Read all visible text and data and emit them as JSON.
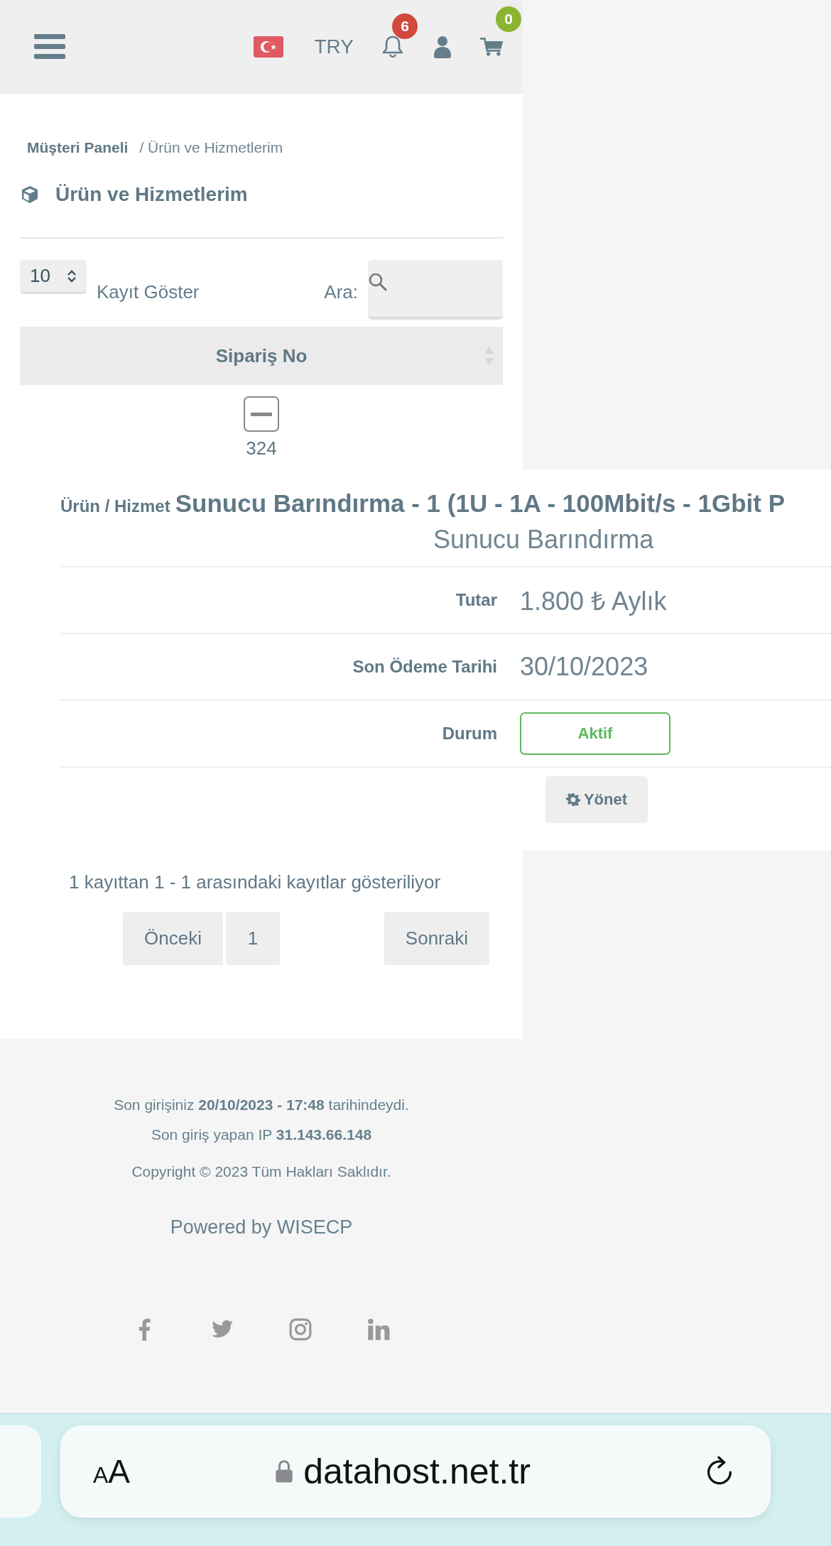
{
  "header": {
    "currency": "TRY",
    "notifications_badge": "6",
    "cart_badge": "0"
  },
  "breadcrumb": [
    {
      "label": "Müşteri Paneli",
      "kind": "link"
    },
    {
      "label": "/ Ürün ve Hizmetlerim",
      "kind": "current"
    }
  ],
  "page_title": "Ürün ve Hizmetlerim",
  "table_controls": {
    "page_size": "10",
    "page_size_label": "Kayıt Göster",
    "search_label": "Ara:"
  },
  "table": {
    "columns": [
      "Sipariş No"
    ],
    "rows": [
      {
        "order_no": "324",
        "expanded": true,
        "details": {
          "product_label": "Ürün / Hizmet",
          "product_value": "Sunucu Barındırma - 1 (1U - 1A - 100Mbit/s - 1Gbit P",
          "category": "Sunucu Barındırma",
          "fields": [
            {
              "kind": "text",
              "label": "Tutar",
              "value": "1.800 ₺ Aylık"
            },
            {
              "kind": "text",
              "label": "Son Ödeme Tarihi",
              "value": "30/10/2023"
            },
            {
              "kind": "status",
              "label": "Durum",
              "value": "Aktif",
              "color": "#5cb85c"
            }
          ],
          "manage_button": "Yönet"
        }
      }
    ]
  },
  "table_info": "1 kayıttan 1 - 1 arasındaki kayıtlar gösteriliyor",
  "pagination": {
    "previous": "Önceki",
    "pages": [
      {
        "label": "1",
        "selected": true
      }
    ],
    "next": "Sonraki"
  },
  "footer": {
    "last_login": "Son girişiniz **20/10/2023 - 17:48** tarihindeydi.",
    "last_ip": "Son giriş yapan IP **31.143.66.148**",
    "copyright": "Copyright © 2023 Tüm Hakları Saklıdır.",
    "powered_by": "Powered by WISECP"
  },
  "browser": {
    "text_size": "AA",
    "url": "datahost.net.tr"
  }
}
